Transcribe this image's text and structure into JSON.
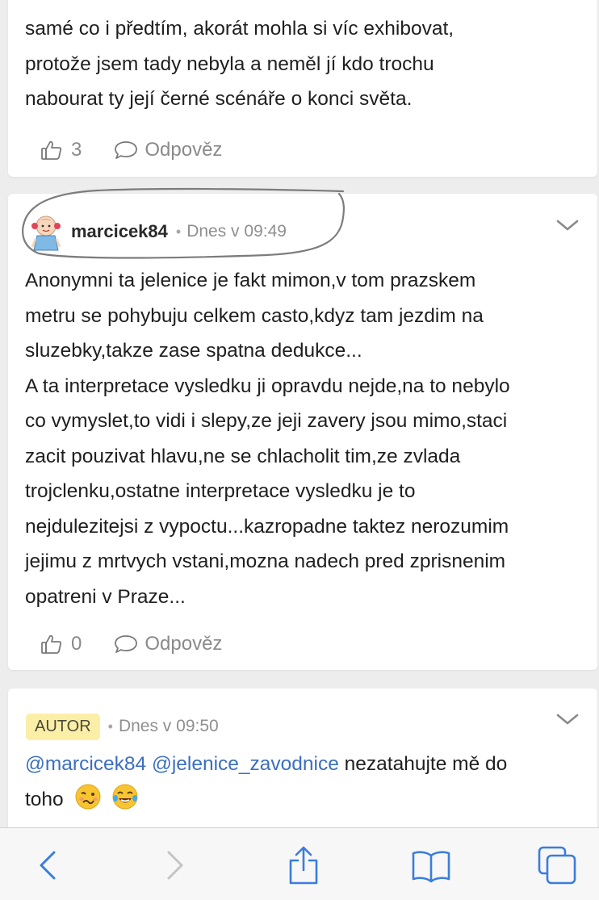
{
  "comments": [
    {
      "lines": [
        "samé co i předtím, akorát mohla si víc exhibovat,",
        "protože jsem tady nebyla a neměl jí kdo trochu",
        "nabourat ty její černé scénáře o konci světa."
      ],
      "likes": "3",
      "reply_label": "Odpověz"
    },
    {
      "author": "marcicek84",
      "dot": "•",
      "time": "Dnes v 09:49",
      "lines": [
        "Anonymni ta jelenice je fakt mimon,v tom prazskem",
        "metru se pohybuju celkem casto,kdyz tam jezdim na",
        "sluzebky,takze zase spatna dedukce...",
        "A ta interpretace vysledku ji opravdu nejde,na to nebylo",
        "co vymyslet,to vidi i slepy,ze jeji zavery jsou mimo,staci",
        "zacit pouzivat hlavu,ne se chlacholit tim,ze zvlada",
        "trojclenku,ostatne interpretace vysledku je to",
        "nejdulezitejsi z vypoctu...kazropadne taktez nerozumim",
        "jejimu z mrtvych vstani,mozna nadech pred zprisnenim",
        "opatreni v Praze..."
      ],
      "likes": "0",
      "reply_label": "Odpověz"
    },
    {
      "badge": "AUTOR",
      "dot": "•",
      "time": "Dnes v 09:50",
      "mention1": "@marcicek84",
      "mention2": "@jelenice_zavodnice",
      "text_after": " nezatahujte mě do",
      "line2": "toho"
    }
  ],
  "icons": {
    "like": "thumbs-up-icon",
    "reply": "speech-bubble-icon",
    "menu": "chevron-down-icon",
    "emoji1": "woozy-face-icon",
    "emoji2": "tears-of-joy-icon",
    "back": "back-arrow-icon",
    "forward": "forward-arrow-icon",
    "share": "share-icon",
    "bookmarks": "open-book-icon",
    "tabs": "tabs-icon"
  },
  "colors": {
    "accent": "#3b7ddd",
    "mention": "#3b6fc0",
    "badge_bg": "#fbefa8",
    "page_bg": "#ededed",
    "muted": "#8a8a8a"
  }
}
